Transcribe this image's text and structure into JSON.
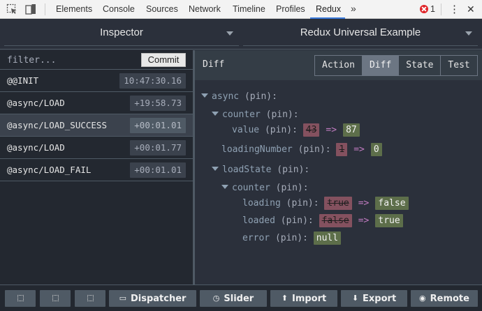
{
  "devtools": {
    "tabs": [
      "Elements",
      "Console",
      "Sources",
      "Network",
      "Timeline",
      "Profiles",
      "Redux"
    ],
    "active_tab": "Redux",
    "overflow_label": "»",
    "error_count": "1",
    "menu_label": "⋮",
    "close_label": "✕",
    "accent": "#3879d9"
  },
  "header": {
    "monitor_label": "Inspector",
    "store_label": "Redux Universal Example"
  },
  "actions": {
    "filter_placeholder": "filter...",
    "commit_label": "Commit",
    "items": [
      {
        "name": "@@INIT",
        "time": "10:47:30.16",
        "selected": false
      },
      {
        "name": "@async/LOAD",
        "time": "+19:58.73",
        "selected": false
      },
      {
        "name": "@async/LOAD_SUCCESS",
        "time": "+00:01.01",
        "selected": true
      },
      {
        "name": "@async/LOAD",
        "time": "+00:01.77",
        "selected": false
      },
      {
        "name": "@async/LOAD_FAIL",
        "time": "+00:01.01",
        "selected": false
      }
    ]
  },
  "diff": {
    "title": "Diff",
    "tabs": [
      "Action",
      "Diff",
      "State",
      "Test"
    ],
    "active_tab": "Diff",
    "pin": "(pin):",
    "arrow": "=>",
    "tree": {
      "async": "async",
      "counter": "counter",
      "value": "value",
      "value_old": "43",
      "value_new": "87",
      "loadingNumber": "loadingNumber",
      "loadingNumber_old": "1",
      "loadingNumber_new": "0",
      "loadState": "loadState",
      "ls_counter": "counter",
      "loading": "loading",
      "loading_old": "true",
      "loading_new": "false",
      "loaded": "loaded",
      "loaded_old": "false",
      "loaded_new": "true",
      "error": "error",
      "error_value": "null"
    },
    "colors": {
      "removed": "#84515f",
      "added": "#5d6e4a",
      "key": "#8fa1b3"
    }
  },
  "toolbar": {
    "dispatcher": "Dispatcher",
    "slider": "Slider",
    "import": "Import",
    "export": "Export",
    "remote": "Remote"
  }
}
